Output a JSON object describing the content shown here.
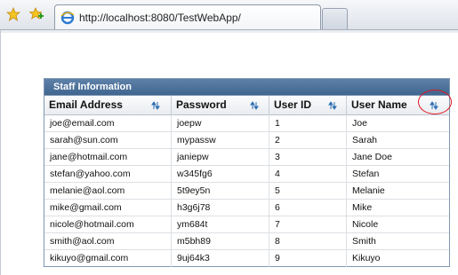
{
  "browser": {
    "back_icon": "star-icon",
    "add_icon": "add-favorite-icon",
    "url": "http://localhost:8080/TestWebApp/"
  },
  "grid": {
    "title": "Staff Information",
    "columns": [
      "Email Address",
      "Password",
      "User ID",
      "User Name"
    ],
    "rows": [
      [
        "joe@email.com",
        "joepw",
        "1",
        "Joe"
      ],
      [
        "sarah@sun.com",
        "mypassw",
        "2",
        "Sarah"
      ],
      [
        "jane@hotmail.com",
        "janiepw",
        "3",
        "Jane Doe"
      ],
      [
        "stefan@yahoo.com",
        "w345fg6",
        "4",
        "Stefan"
      ],
      [
        "melanie@aol.com",
        "5t9ey5n",
        "5",
        "Melanie"
      ],
      [
        "mike@gmail.com",
        "h3g6j78",
        "6",
        "Mike"
      ],
      [
        "nicole@hotmail.com",
        "ym684t",
        "7",
        "Nicole"
      ],
      [
        "smith@aol.com",
        "m5bh89",
        "8",
        "Smith"
      ],
      [
        "kikuyo@gmail.com",
        "9uj64k3",
        "9",
        "Kikuyo"
      ]
    ]
  },
  "colors": {
    "title_bar": "#4a6e99",
    "highlight": "#e0141c"
  }
}
